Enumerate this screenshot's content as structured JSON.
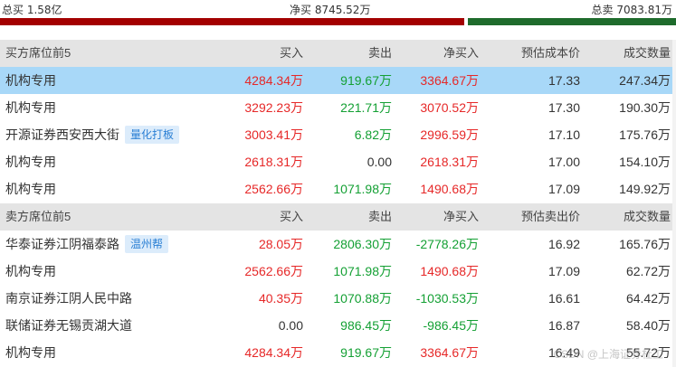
{
  "summary": {
    "total_buy": "总买 1.58亿",
    "net_buy": "净买 8745.52万",
    "total_sell": "总卖 7083.81万",
    "buy_ratio": 0.69
  },
  "buy_section": {
    "headers": [
      "买方席位前5",
      "买入",
      "卖出",
      "净买入",
      "预估成本价",
      "成交数量"
    ],
    "rows": [
      {
        "name": "机构专用",
        "tag": "",
        "buy": "4284.34万",
        "sell": "919.67万",
        "net": "3364.67万",
        "price": "17.33",
        "volume": "247.34万"
      },
      {
        "name": "机构专用",
        "tag": "",
        "buy": "3292.23万",
        "sell": "221.71万",
        "net": "3070.52万",
        "price": "17.30",
        "volume": "190.30万"
      },
      {
        "name": "开源证券西安西大街",
        "tag": "量化打板",
        "buy": "3003.41万",
        "sell": "6.82万",
        "net": "2996.59万",
        "price": "17.10",
        "volume": "175.76万"
      },
      {
        "name": "机构专用",
        "tag": "",
        "buy": "2618.31万",
        "sell": "0.00",
        "net": "2618.31万",
        "price": "17.00",
        "volume": "154.10万"
      },
      {
        "name": "机构专用",
        "tag": "",
        "buy": "2562.66万",
        "sell": "1071.98万",
        "net": "1490.68万",
        "price": "17.09",
        "volume": "149.92万"
      }
    ]
  },
  "sell_section": {
    "headers": [
      "卖方席位前5",
      "买入",
      "卖出",
      "净买入",
      "预估卖出价",
      "成交数量"
    ],
    "rows": [
      {
        "name": "华泰证券江阴福泰路",
        "tag": "温州帮",
        "buy": "28.05万",
        "sell": "2806.30万",
        "net": "-2778.26万",
        "price": "16.92",
        "volume": "165.76万"
      },
      {
        "name": "机构专用",
        "tag": "",
        "buy": "2562.66万",
        "sell": "1071.98万",
        "net": "1490.68万",
        "price": "17.09",
        "volume": "62.72万"
      },
      {
        "name": "南京证券江阴人民中路",
        "tag": "",
        "buy": "40.35万",
        "sell": "1070.88万",
        "net": "-1030.53万",
        "price": "16.61",
        "volume": "64.42万"
      },
      {
        "name": "联储证券无锡贡湖大道",
        "tag": "",
        "buy": "0.00",
        "sell": "986.45万",
        "net": "-986.45万",
        "price": "16.87",
        "volume": "58.40万"
      },
      {
        "name": "机构专用",
        "tag": "",
        "buy": "4284.34万",
        "sell": "919.67万",
        "net": "3364.67万",
        "price": "16.49",
        "volume": "55.72万"
      }
    ]
  },
  "watermark": "CSDN @上海证券杜工",
  "colors": {
    "up": "#e62828",
    "down": "#14a034",
    "highlight": "#a8d8f8",
    "header_bg": "#e4e4e4"
  }
}
